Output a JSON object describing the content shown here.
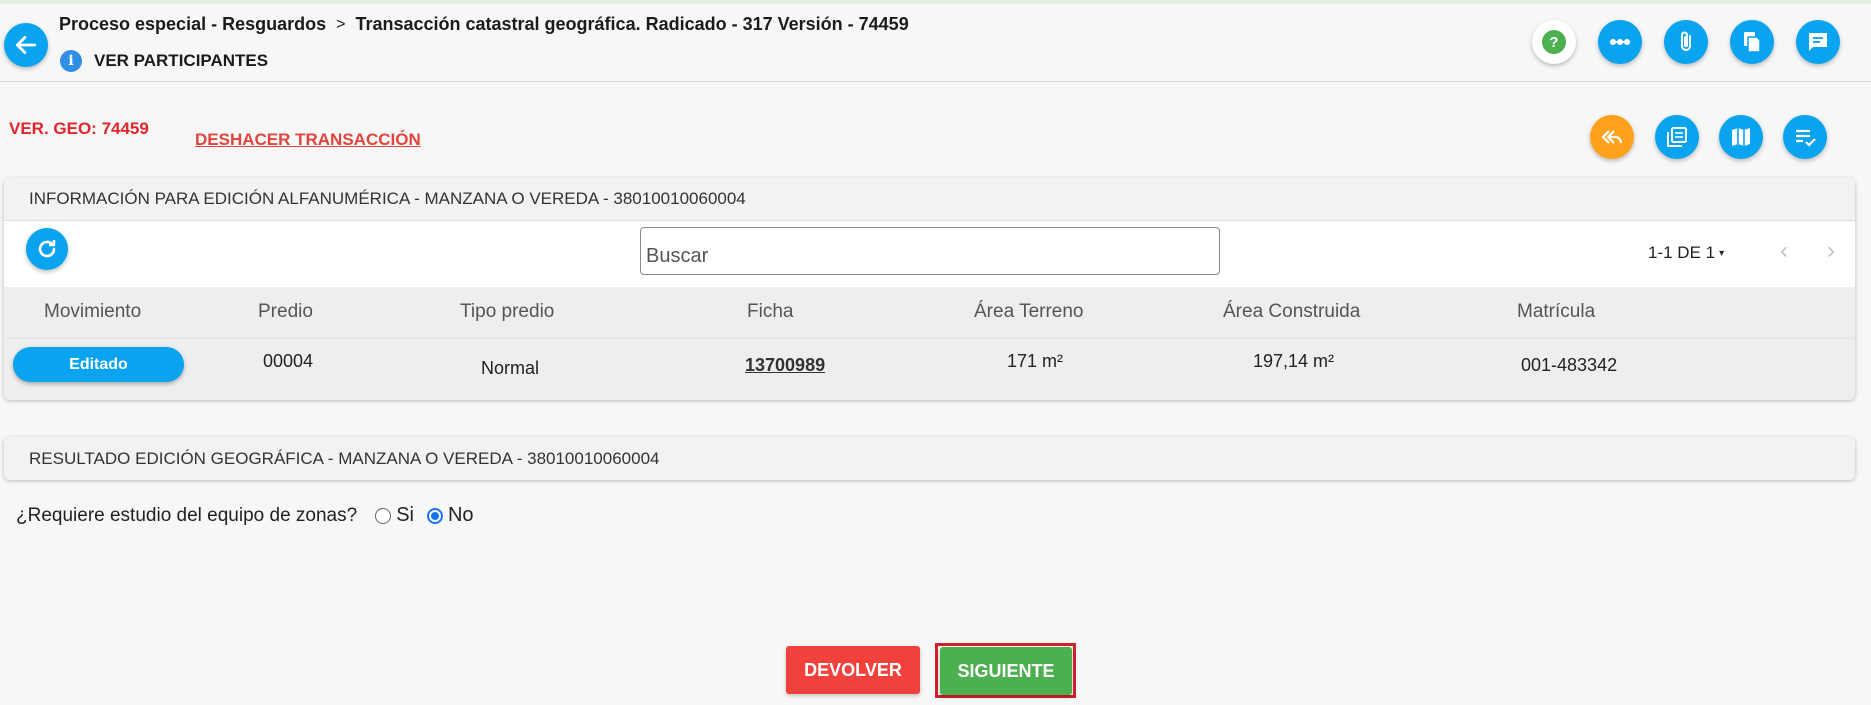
{
  "header": {
    "breadcrumb_parent": "Proceso especial - Resguardos",
    "breadcrumb_separator": ">",
    "breadcrumb_current": "Transacción catastral geográfica. Radicado - 317 Versión - 74459",
    "participants_label": "VER PARTICIPANTES",
    "info_icon_glyph": "i",
    "top_actions": [
      "help-icon",
      "workflow-icon",
      "attachment-icon",
      "documents-icon",
      "comments-icon"
    ]
  },
  "version": {
    "geo_label": "VER. GEO: 74459",
    "undo_label": "DESHACER TRANSACCIÓN",
    "actions": [
      "return-all-icon",
      "copy-icon",
      "map-icon",
      "checklist-icon"
    ]
  },
  "panel_alfanumerica": {
    "title": "INFORMACIÓN PARA EDICIÓN ALFANUMÉRICA - MANZANA O VEREDA - 38010010060004",
    "search_placeholder": "Buscar",
    "pager_label": "1-1 DE 1",
    "pager_caret": "▾",
    "prev_glyph": "‹",
    "next_glyph": "›",
    "columns": [
      "Movimiento",
      "Predio",
      "Tipo predio",
      "Ficha",
      "Área Terreno",
      "Área Construida",
      "Matrícula"
    ],
    "rows": [
      {
        "movimiento": "Editado",
        "predio": "00004",
        "tipo_predio": "Normal",
        "ficha": "13700989",
        "area_terreno": "171 m²",
        "area_construida": "197,14 m²",
        "matricula": "001-483342"
      }
    ]
  },
  "panel_geografica": {
    "title": "RESULTADO EDICIÓN GEOGRÁFICA - MANZANA O VEREDA - 38010010060004"
  },
  "question": {
    "text": "¿Requiere estudio del equipo de zonas?",
    "option_yes": "Si",
    "option_no": "No",
    "selected": "No"
  },
  "footer": {
    "return_label": "DEVOLVER",
    "next_label": "SIGUIENTE"
  },
  "colors": {
    "primary": "#0aa3f0",
    "accent_orange": "#ffa11a",
    "danger": "#f0413c",
    "success": "#4caf50",
    "highlight_frame": "#d0202a",
    "help_green": "#4caf50"
  }
}
